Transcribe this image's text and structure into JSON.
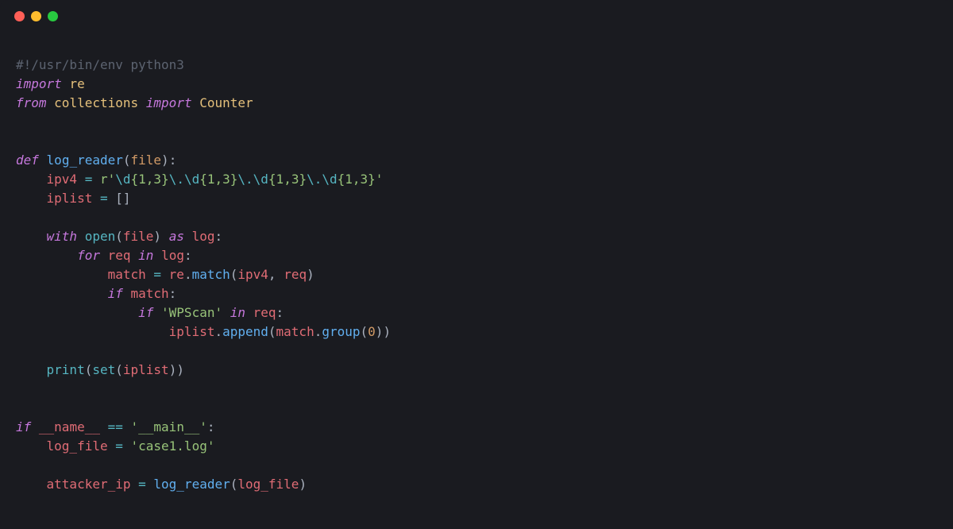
{
  "colors": {
    "background": "#1a1b20",
    "traffic_red": "#ff5f57",
    "traffic_yellow": "#febc2e",
    "traffic_green": "#28c840"
  },
  "code": {
    "shebang": "#!/usr/bin/env python3",
    "import1_kw": "import",
    "import1_mod": "re",
    "from_kw": "from",
    "collections_mod": "collections",
    "import2_kw": "import",
    "counter_cls": "Counter",
    "def_kw": "def",
    "func_name": "log_reader",
    "func_param": "file",
    "ipv4_var": "ipv4",
    "ipv4_str_prefix": "r",
    "ipv4_str_q": "'",
    "ipv4_str_d": "\\d",
    "ipv4_str_b1": "{1,3}",
    "ipv4_str_dot": "\\.",
    "iplist_var": "iplist",
    "with_kw": "with",
    "open_fn": "open",
    "file_var": "file",
    "as_kw": "as",
    "log_var": "log",
    "for_kw": "for",
    "req_var": "req",
    "in_kw": "in",
    "match_var": "match",
    "re_mod": "re",
    "match_fn": "match",
    "if_kw": "if",
    "wpscan_str": "'WPScan'",
    "append_fn": "append",
    "group_fn": "group",
    "zero": "0",
    "print_fn": "print",
    "set_fn": "set",
    "name_var": "__name__",
    "eq_op": "==",
    "main_str": "'__main__'",
    "logfile_var": "log_file",
    "case1_str": "'case1.log'",
    "attacker_var": "attacker_ip",
    "eq": " = ",
    "colon": ":",
    "lparen": "(",
    "rparen": ")",
    "lbrack": "[",
    "rbrack": "]",
    "comma": ", ",
    "dot": "."
  }
}
